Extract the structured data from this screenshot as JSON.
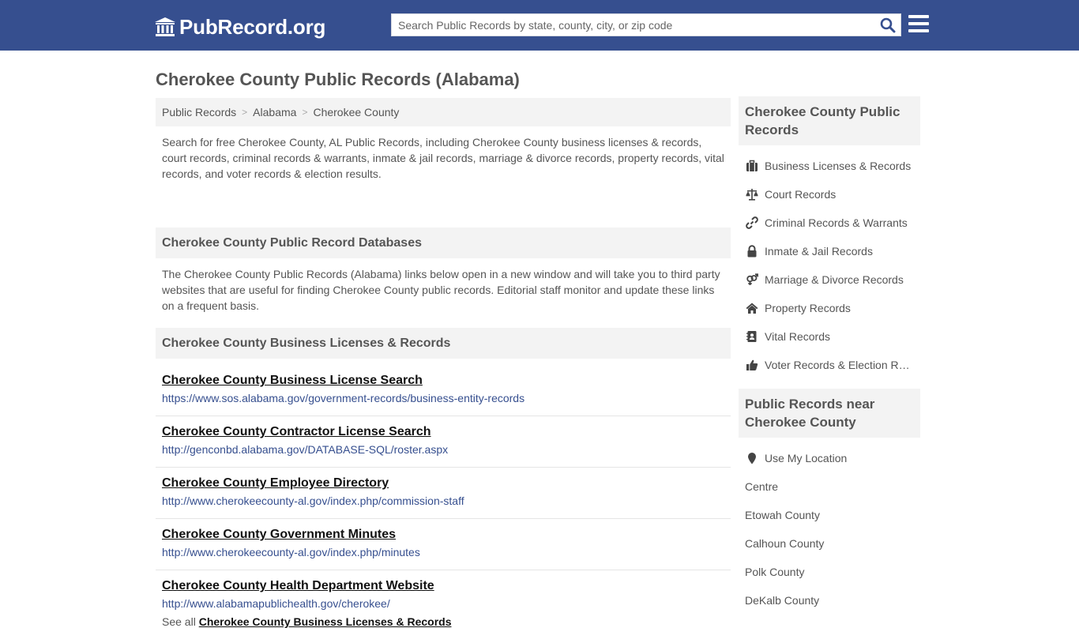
{
  "header": {
    "logo_text": "PubRecord.org",
    "search_placeholder": "Search Public Records by state, county, city, or zip code",
    "search_value": ""
  },
  "page_title": "Cherokee County Public Records (Alabama)",
  "breadcrumb": [
    "Public Records",
    "Alabama",
    "Cherokee County"
  ],
  "breadcrumb_sep": ">",
  "intro": "Search for free Cherokee County, AL Public Records, including Cherokee County business licenses & records, court records, criminal records & warrants, inmate & jail records, marriage & divorce records, property records, vital records, and voter records & election results.",
  "databases": {
    "heading": "Cherokee County Public Record Databases",
    "text": "The Cherokee County Public Records (Alabama) links below open in a new window and will take you to third party websites that are useful for finding Cherokee County public records. Editorial staff monitor and update these links on a frequent basis."
  },
  "business": {
    "heading": "Cherokee County Business Licenses & Records",
    "links": [
      {
        "title": "Cherokee County Business License Search",
        "url": "https://www.sos.alabama.gov/government-records/business-entity-records"
      },
      {
        "title": "Cherokee County Contractor License Search",
        "url": "http://genconbd.alabama.gov/DATABASE-SQL/roster.aspx"
      },
      {
        "title": "Cherokee County Employee Directory",
        "url": "http://www.cherokeecounty-al.gov/index.php/commission-staff"
      },
      {
        "title": "Cherokee County Government Minutes",
        "url": "http://www.cherokeecounty-al.gov/index.php/minutes"
      },
      {
        "title": "Cherokee County Health Department Website",
        "url": "http://www.alabamapublichealth.gov/cherokee/"
      }
    ],
    "see_all_prefix": "See all",
    "see_all_link": "Cherokee County Business Licenses & Records"
  },
  "sidebar": {
    "records_heading": "Cherokee County Public Records",
    "records": [
      {
        "icon": "briefcase-icon",
        "label": "Business Licenses & Records"
      },
      {
        "icon": "balance-scale-icon",
        "label": "Court Records"
      },
      {
        "icon": "link-icon",
        "label": "Criminal Records & Warrants"
      },
      {
        "icon": "lock-icon",
        "label": "Inmate & Jail Records"
      },
      {
        "icon": "venus-mars-icon",
        "label": "Marriage & Divorce Records"
      },
      {
        "icon": "home-icon",
        "label": "Property Records"
      },
      {
        "icon": "address-book-icon",
        "label": "Vital Records"
      },
      {
        "icon": "thumbs-up-icon",
        "label": "Voter Records & Election Results"
      }
    ],
    "near_heading": "Public Records near Cherokee County",
    "use_location": "Use My Location",
    "near": [
      "Centre",
      "Etowah County",
      "Calhoun County",
      "Polk County",
      "DeKalb County"
    ]
  }
}
